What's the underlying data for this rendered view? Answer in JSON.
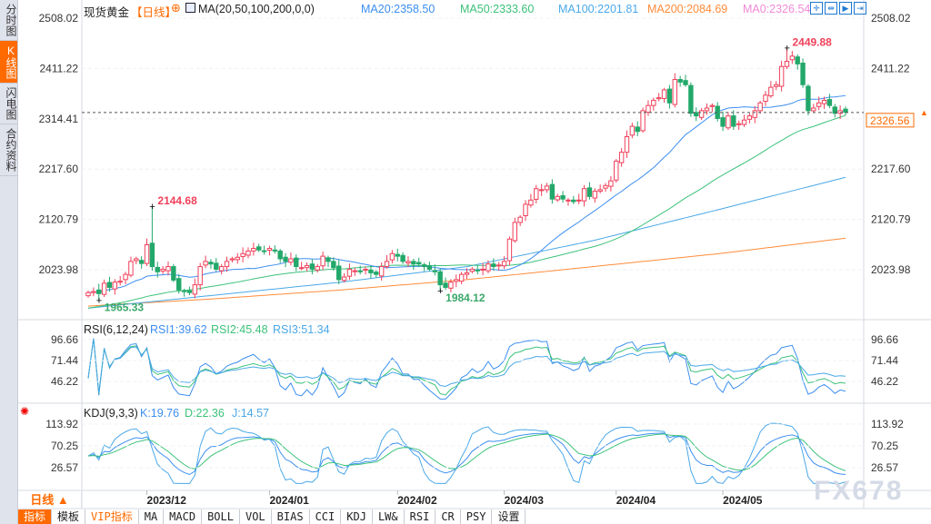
{
  "sidebar": {
    "items": [
      {
        "label": "分时图",
        "active": false
      },
      {
        "label": "K线图",
        "active": true
      },
      {
        "label": "闪电图",
        "active": false
      },
      {
        "label": "合约资料",
        "active": false
      }
    ]
  },
  "header": {
    "symbol": "现货黄金",
    "period": "【日线】",
    "ma_title": "MA(20,50,100,200,0,0)",
    "ma": [
      {
        "label": "MA20:2358.50",
        "color": "#3c8ef0"
      },
      {
        "label": "MA50:2333.60",
        "color": "#3cc27a"
      },
      {
        "label": "MA100:2201.81",
        "color": "#4aa8e8"
      },
      {
        "label": "MA200:2084.69",
        "color": "#ff8c3a"
      },
      {
        "label": "MA0:2326.54",
        "color": "#f08ad8"
      }
    ],
    "tools": [
      "crosshair-icon",
      "zoom-fit-icon",
      "play-icon",
      "exit-icon"
    ]
  },
  "rsi": {
    "title": "RSI(6,12,24)",
    "values": [
      {
        "label": "RSI1:39.62",
        "color": "#3c8ef0"
      },
      {
        "label": "RSI2:45.48",
        "color": "#3cc27a"
      },
      {
        "label": "RSI3:51.34",
        "color": "#4aa8e8"
      }
    ],
    "ticks": [
      "96.66",
      "71.44",
      "46.22"
    ]
  },
  "kdj": {
    "title": "KDJ(9,3,3)",
    "values": [
      {
        "label": "K:19.76",
        "color": "#3c8ef0"
      },
      {
        "label": "D:22.36",
        "color": "#3cc27a"
      },
      {
        "label": "J:14.57",
        "color": "#4aa8e8"
      }
    ],
    "ticks": [
      "113.92",
      "70.25",
      "26.57"
    ]
  },
  "current_price": "2326.56",
  "period_button": "日线 ▲",
  "tabs": [
    "指标",
    "模板",
    "VIP指标",
    "MA",
    "MACD",
    "BOLL",
    "VOL",
    "BIAS",
    "CCI",
    "KDJ",
    "LW&",
    "RSI",
    "CR",
    "PSY",
    "设置"
  ],
  "watermark": "FX678",
  "colors": {
    "up": "#f0405a",
    "down": "#22a86a",
    "accent": "#ff6a00"
  },
  "chart_data": {
    "type": "candlestick",
    "y_ticks": [
      "2508.02",
      "2411.22",
      "2314.41",
      "2217.60",
      "2120.79",
      "2023.98"
    ],
    "ylim": [
      1940,
      2520
    ],
    "x_ticks": [
      {
        "label": "2023/12",
        "index": 11
      },
      {
        "label": "2024/01",
        "index": 34
      },
      {
        "label": "2024/02",
        "index": 58
      },
      {
        "label": "2024/03",
        "index": 78
      },
      {
        "label": "2024/04",
        "index": 99
      },
      {
        "label": "2024/05",
        "index": 119
      }
    ],
    "close": [
      1980,
      1982,
      1978,
      1998,
      1990,
      2000,
      2002,
      2015,
      2040,
      2045,
      2036,
      2072,
      2030,
      2020,
      2025,
      2030,
      2004,
      1985,
      1982,
      1980,
      1995,
      2030,
      2040,
      2035,
      2025,
      2030,
      2040,
      2045,
      2048,
      2055,
      2060,
      2065,
      2062,
      2060,
      2065,
      2060,
      2045,
      2040,
      2045,
      2030,
      2028,
      2032,
      2025,
      2030,
      2050,
      2040,
      2028,
      2005,
      2010,
      2025,
      2022,
      2020,
      2025,
      2018,
      2015,
      2030,
      2040,
      2055,
      2050,
      2040,
      2040,
      2035,
      2035,
      2030,
      2025,
      2020,
      1995,
      1990,
      2000,
      2005,
      2015,
      2018,
      2025,
      2022,
      2025,
      2035,
      2030,
      2033,
      2040,
      2083,
      2115,
      2125,
      2150,
      2158,
      2180,
      2178,
      2185,
      2160,
      2165,
      2160,
      2158,
      2155,
      2158,
      2180,
      2165,
      2175,
      2178,
      2186,
      2195,
      2233,
      2250,
      2280,
      2300,
      2290,
      2330,
      2340,
      2350,
      2355,
      2370,
      2345,
      2390,
      2385,
      2380,
      2325,
      2320,
      2330,
      2335,
      2340,
      2315,
      2300,
      2320,
      2300,
      2305,
      2312,
      2320,
      2330,
      2345,
      2360,
      2375,
      2380,
      2415,
      2425,
      2435,
      2420,
      2380,
      2330,
      2335,
      2345,
      2350,
      2340,
      2325,
      2330,
      2327
    ],
    "annotations": [
      {
        "label": "2144.68",
        "value": 2144.68,
        "index": 12,
        "kind": "high"
      },
      {
        "label": "1965.33",
        "value": 1965.33,
        "index": 2,
        "kind": "low"
      },
      {
        "label": "1984.12",
        "value": 1984.12,
        "index": 66,
        "kind": "low"
      },
      {
        "label": "2449.88",
        "value": 2449.88,
        "index": 131,
        "kind": "high"
      }
    ],
    "ma100": [
      1950,
      1975,
      2000,
      2030,
      2080,
      2140,
      2201.81
    ],
    "ma200": [
      1954,
      1968,
      1985,
      2005,
      2030,
      2055,
      2084.69
    ]
  }
}
